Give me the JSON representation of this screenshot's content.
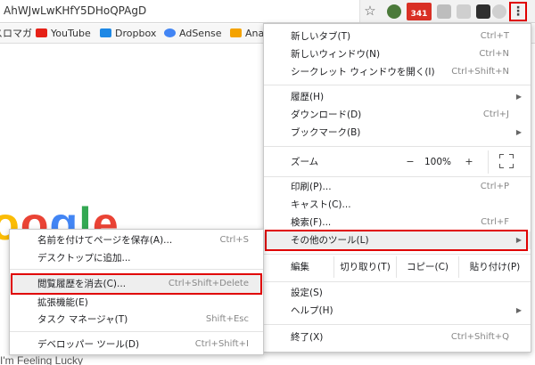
{
  "address_bar": {
    "url": "AhWJwLwKHfY5DHoQPAgD",
    "star_glyph": "☆",
    "mail_badge": "341"
  },
  "menu_button_glyph": "⋮",
  "bookmarks": [
    {
      "label": "スロマガ",
      "icon_color": "#9e9e9e"
    },
    {
      "label": "YouTube",
      "icon_color": "#e62117"
    },
    {
      "label": "Dropbox",
      "icon_color": "#1e88e5"
    },
    {
      "label": "AdSense",
      "icon_color": "#4285f4"
    },
    {
      "label": "Ana",
      "icon_color": "#f4a300"
    }
  ],
  "page": {
    "logo_letters": [
      {
        "ch": "o",
        "color": "#fbbc05"
      },
      {
        "ch": "o",
        "color": "#ea4335"
      },
      {
        "ch": "g",
        "color": "#4285f4"
      },
      {
        "ch": "l",
        "color": "#34a853"
      },
      {
        "ch": "e",
        "color": "#ea4335"
      }
    ],
    "lucky": "I'm Feeling Lucky"
  },
  "menu": {
    "new_tab": {
      "label": "新しいタブ(T)",
      "shortcut": "Ctrl+T"
    },
    "new_window": {
      "label": "新しいウィンドウ(N)",
      "shortcut": "Ctrl+N"
    },
    "incognito": {
      "label": "シークレット ウィンドウを開く(I)",
      "shortcut": "Ctrl+Shift+N"
    },
    "history": {
      "label": "履歴(H)"
    },
    "downloads": {
      "label": "ダウンロード(D)",
      "shortcut": "Ctrl+J"
    },
    "bookmarks": {
      "label": "ブックマーク(B)"
    },
    "zoom": {
      "label": "ズーム",
      "minus": "−",
      "value": "100%",
      "plus": "+"
    },
    "print": {
      "label": "印刷(P)...",
      "shortcut": "Ctrl+P"
    },
    "cast": {
      "label": "キャスト(C)..."
    },
    "find": {
      "label": "検索(F)...",
      "shortcut": "Ctrl+F"
    },
    "more_tools": {
      "label": "その他のツール(L)"
    },
    "edit": {
      "label": "編集",
      "cut": "切り取り(T)",
      "copy": "コピー(C)",
      "paste": "貼り付け(P)"
    },
    "settings": {
      "label": "設定(S)"
    },
    "help": {
      "label": "ヘルプ(H)"
    },
    "exit": {
      "label": "終了(X)",
      "shortcut": "Ctrl+Shift+Q"
    },
    "arrow": "▶"
  },
  "submenu": {
    "save_page": {
      "label": "名前を付けてページを保存(A)...",
      "shortcut": "Ctrl+S"
    },
    "add_desktop": {
      "label": "デスクトップに追加..."
    },
    "clear_data": {
      "label": "閲覧履歴を消去(C)...",
      "shortcut": "Ctrl+Shift+Delete"
    },
    "extensions": {
      "label": "拡張機能(E)"
    },
    "task_manager": {
      "label": "タスク マネージャ(T)",
      "shortcut": "Shift+Esc"
    },
    "devtools": {
      "label": "デベロッパー ツール(D)",
      "shortcut": "Ctrl+Shift+I"
    }
  },
  "colors": {
    "highlight": "#e00000"
  }
}
